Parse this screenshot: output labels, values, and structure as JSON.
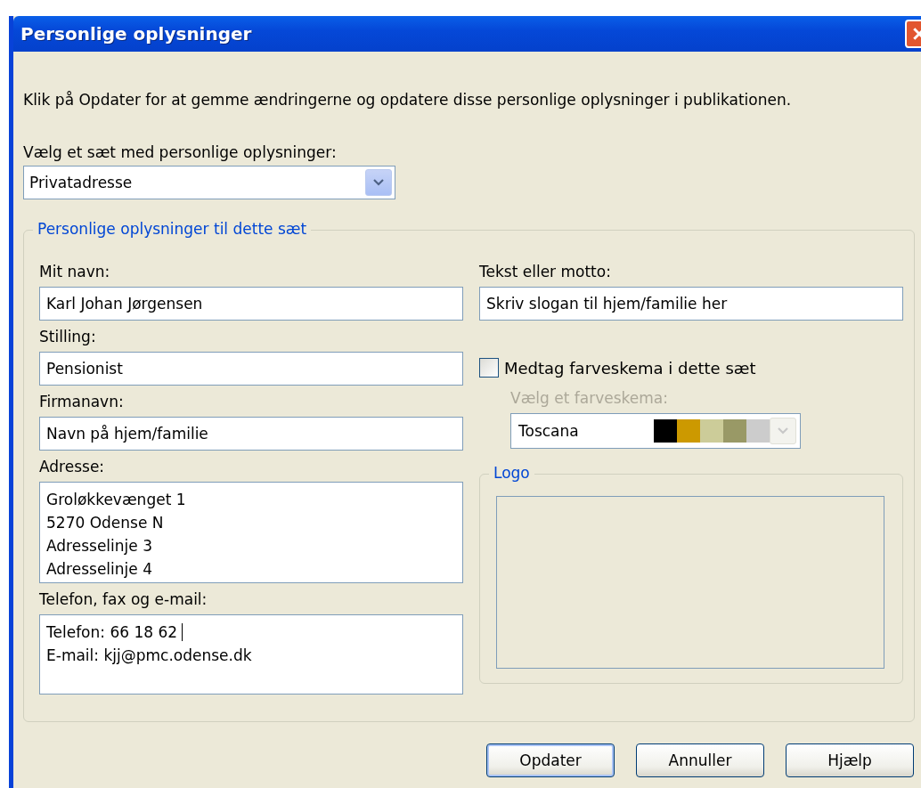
{
  "window": {
    "title": "Personlige oplysninger"
  },
  "intro": "Klik på Opdater for at gemme ændringerne og opdatere disse personlige oplysninger i publikationen.",
  "set_select": {
    "label": "Vælg et sæt med personlige oplysninger:",
    "value": "Privatadresse"
  },
  "group": {
    "title": "Personlige oplysninger til dette sæt",
    "left_fields": [
      {
        "kind": "line",
        "label": "Mit navn:",
        "value": "Karl Johan Jørgensen"
      },
      {
        "kind": "line",
        "label": "Stilling:",
        "value": "Pensionist"
      },
      {
        "kind": "line",
        "label": "Firmanavn:",
        "value": "Navn på hjem/familie"
      },
      {
        "kind": "multi",
        "label": "Adresse:",
        "lines": [
          "Groløkkevænget 1",
          "5270 Odense N",
          "Adresselinje 3",
          "Adresselinje 4"
        ],
        "caret": false
      },
      {
        "kind": "multi",
        "label": "Telefon, fax og e-mail:",
        "lines": [
          "Telefon: 66 18 62",
          "E-mail: kjj@pmc.odense.dk"
        ],
        "caret": true
      }
    ],
    "motto": {
      "label": "Tekst eller motto:",
      "value": "Skriv slogan til hjem/familie her"
    },
    "color_option": {
      "label": "Medtag farveskema i dette sæt",
      "checked": false
    },
    "scheme": {
      "label": "Vælg et farveskema:",
      "value": "Toscana",
      "disabled": true,
      "swatches": [
        {
          "color": "#000000"
        },
        {
          "color": "#cc9900"
        },
        {
          "color": "#cccc99"
        },
        {
          "color": "#999966"
        },
        {
          "color": "#cccccc"
        }
      ]
    },
    "logo": {
      "title": "Logo"
    }
  },
  "buttons": [
    {
      "label": "Opdater",
      "default": true
    },
    {
      "label": "Annuller",
      "default": false
    },
    {
      "label": "Hjælp",
      "default": false
    }
  ]
}
